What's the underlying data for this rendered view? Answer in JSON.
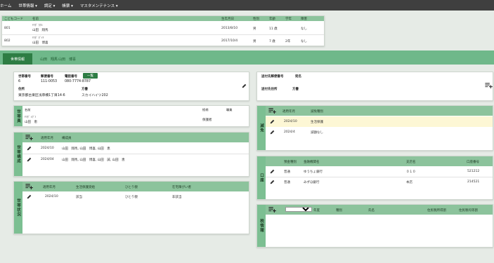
{
  "nav": [
    "ホーム",
    "世帯情報 ▾",
    "調定 ▾",
    "帳票 ▾",
    "マスタメンテナンス ▾"
  ],
  "children": {
    "headers": [
      "こどもコード",
      "名前",
      "生年月日",
      "性別",
      "年齢",
      "学年",
      "障害"
    ],
    "rows": [
      {
        "code": "801",
        "kana": "ﾔﾏﾀﾞ ｶｹﾙ",
        "name": "山田　翔馬",
        "dob": "2013/8/10",
        "sex": "男",
        "age": "11 歳",
        "grade": "",
        "disability": "なし"
      },
      {
        "code": "802",
        "kana": "ﾔﾏﾀﾞ ﾀﾞｲｷ",
        "name": "山田　博喜",
        "dob": "2017/10/4",
        "sex": "男",
        "age": "7 歳",
        "grade": "2年",
        "disability": "なし"
      }
    ]
  },
  "tabs": {
    "active": "世帯情報",
    "others": [
      "山田　翔馬",
      "山田　博喜"
    ]
  },
  "household": {
    "id_label": "世帯番号",
    "id": "6",
    "zip_label": "郵便番号",
    "zip": "111-0053",
    "tel_label": "電話番号",
    "tel": "080-7774-8787",
    "list_button": "一覧",
    "addr_label": "住所",
    "addr": "東京都台東区浅草橋1丁目14-6",
    "katagaki_label": "方書",
    "katagaki": "スカイハイツ202"
  },
  "send": {
    "zip_label": "送付先郵便番号",
    "name_label": "宛名",
    "addr_label": "送付先住所",
    "katagaki_label": "方書"
  },
  "guardian": {
    "side": "世帯員",
    "headers": [
      "名前",
      "続柄",
      "職業"
    ],
    "kana": "ﾔﾏﾀﾞ ﾒｸﾞﾐ",
    "name": "山田　恵",
    "relation": "保護者"
  },
  "household_members": {
    "side": "世帯構成",
    "headers": [
      "適用年月",
      "構成員"
    ],
    "rows": [
      {
        "month": "2024/10",
        "members": "山田　翔馬, 山田　博喜, 山田　恵"
      },
      {
        "month": "2024/04",
        "members": "山田　翔馬, 山田　博喜, 山田　誠, 山田　恵"
      }
    ]
  },
  "status": {
    "side": "世帯状況",
    "headers": [
      "適用年月",
      "生活保護受給",
      "ひとり親",
      "在宅障がい者"
    ],
    "rows": [
      {
        "month": "2024/10",
        "welfare": "該当",
        "single": "ひとり親",
        "disabled": "非該当"
      }
    ]
  },
  "exemption": {
    "side": "減免",
    "headers": [
      "適用年月",
      "減免種別"
    ],
    "rows": [
      {
        "month": "2024/10",
        "type": "生活保護"
      },
      {
        "month": "2024/4",
        "type": "減額なし"
      }
    ]
  },
  "account": {
    "side": "口座",
    "headers": [
      "預金種別",
      "金融機関名",
      "支店名",
      "口座番号"
    ],
    "rows": [
      {
        "type": "普通",
        "bank": "ゆうちょ銀行",
        "branch": "０１０",
        "number": "521212"
      },
      {
        "type": "普通",
        "bank": "みずほ銀行",
        "branch": "本店",
        "number": "214521"
      }
    ]
  },
  "tax": {
    "side": "税情報",
    "headers": [
      "年度",
      "種別",
      "氏名",
      "住民税所得割",
      "住民税均等割"
    ]
  }
}
